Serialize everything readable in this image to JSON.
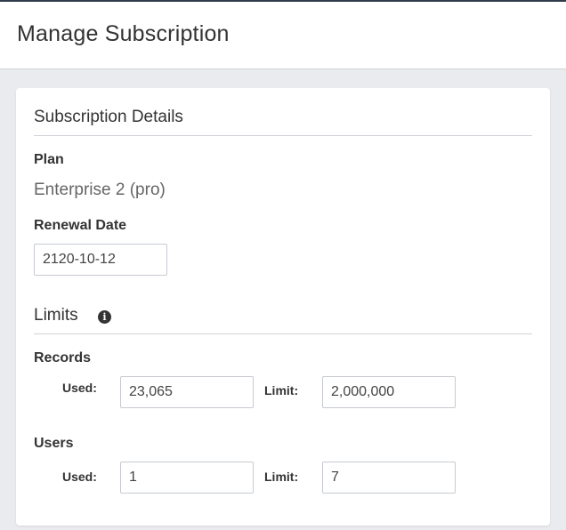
{
  "header": {
    "title": "Manage Subscription"
  },
  "details": {
    "title": "Subscription Details",
    "plan_label": "Plan",
    "plan_value": "Enterprise 2 (pro)",
    "renewal_label": "Renewal Date",
    "renewal_value": "2120-10-12"
  },
  "limits": {
    "title": "Limits",
    "info_icon": "info-icon",
    "records": {
      "label": "Records",
      "used_label": "Used:",
      "used_value": "23,065",
      "limit_label": "Limit:",
      "limit_value": "2,000,000"
    },
    "users": {
      "label": "Users",
      "used_label": "Used:",
      "used_value": "1",
      "limit_label": "Limit:",
      "limit_value": "7"
    }
  }
}
